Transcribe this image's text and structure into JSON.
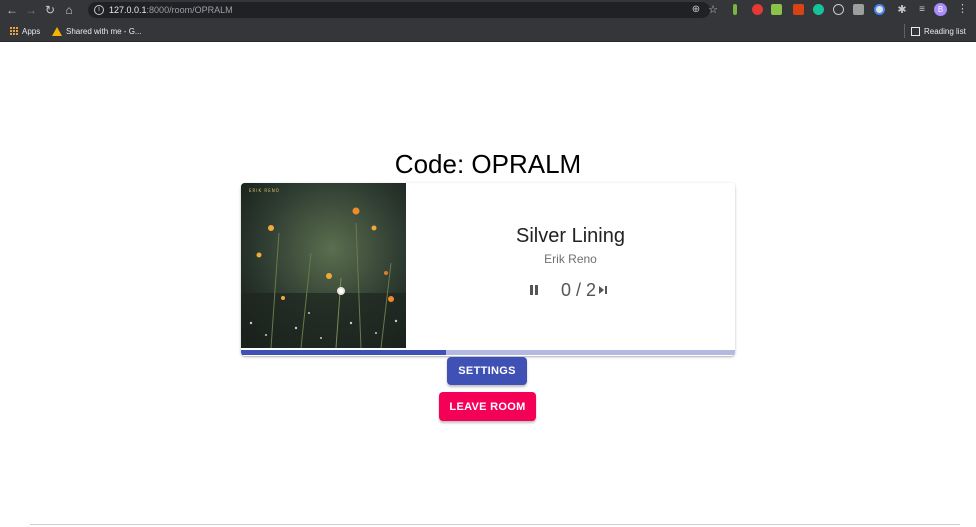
{
  "browser": {
    "url_host": "127.0.0.1",
    "url_path": ":8000/room/OPRALM",
    "profile_initial": "B",
    "icons": {
      "back": "back-arrow-icon",
      "forward": "forward-arrow-icon",
      "reload": "reload-icon",
      "home": "home-icon",
      "zoom": "zoom-icon",
      "star": "bookmark-star-icon",
      "extensions": "extensions-icon",
      "playlist": "media-playlist-icon",
      "menu": "kebab-menu-icon"
    },
    "bookmarks": [
      {
        "label": "Apps",
        "icon": "apps-grid-icon"
      },
      {
        "label": "Shared with me - G...",
        "icon": "google-drive-icon"
      }
    ],
    "reading_list_label": "Reading list"
  },
  "room": {
    "title": "Code: OPRALM"
  },
  "player": {
    "album_label": "ERIK RENO",
    "song_title": "Silver Lining",
    "artist": "Erik Reno",
    "votes_text": "0 / 2",
    "progress_fraction": 0.415,
    "accent_color": "#3f51b5",
    "accent_light": "#b3b9e0"
  },
  "buttons": {
    "settings_label": "SETTINGS",
    "leave_label": "LEAVE ROOM",
    "settings_color": "#3f51b5",
    "leave_color": "#f50057"
  }
}
